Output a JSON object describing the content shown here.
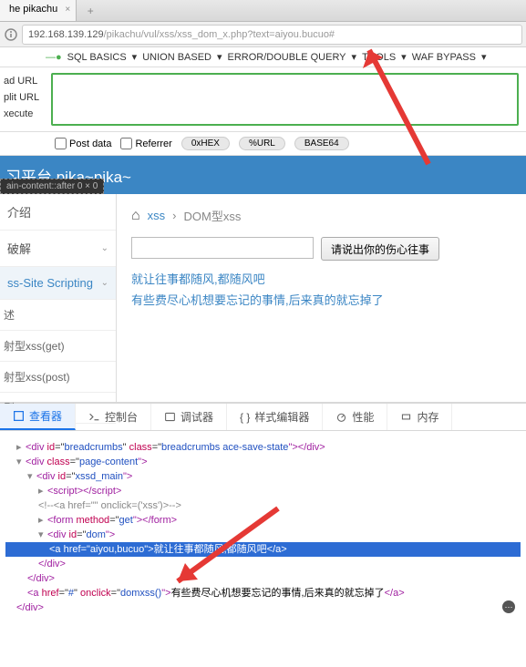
{
  "tab": {
    "title": "he pikachu"
  },
  "url": {
    "host": "192.168.139.129",
    "path": "/pikachu/vul/xss/xss_dom_x.php?text=aiyou.bucuo#"
  },
  "hackbar": {
    "items": [
      "SQL BASICS",
      "UNION BASED",
      "ERROR/DOUBLE QUERY",
      "TOOLS",
      "WAF BYPASS"
    ],
    "left": [
      "ad URL",
      "plit URL",
      "xecute"
    ],
    "opts": {
      "post": "Post data",
      "ref": "Referrer",
      "hex": "0xHEX",
      "url": "%URL",
      "b64": "BASE64"
    }
  },
  "page": {
    "title": "习平台 pika~pika~",
    "badge": "ain-content::after      0 × 0",
    "crumb": {
      "l1": "xss",
      "l2": "DOM型xss"
    },
    "btn": "请说出你的伤心往事",
    "link1": "就让往事都随风,都随风吧",
    "link2": "有些费尽心机想要忘记的事情,后来真的就忘掉了"
  },
  "sidebar": {
    "items": [
      "介绍",
      "破解"
    ],
    "open": "ss-Site Scripting",
    "subs": [
      "述",
      "射型xss(get)",
      "射型xss(post)",
      "型"
    ]
  },
  "devtools": {
    "tabs": [
      "查看器",
      "控制台",
      "调试器",
      "样式编辑器",
      "性能",
      "内存"
    ],
    "code": {
      "l1a": "<div ",
      "l1b": "id",
      "l1c": "=\"",
      "l1d": "breadcrumbs",
      "l1e": "\" ",
      "l1f": "class",
      "l1g": "=\"",
      "l1h": "breadcrumbs ace-save-state",
      "l1i": "\"></div>",
      "l2a": "<div ",
      "l2b": "class",
      "l2c": "=\"",
      "l2d": "page-content",
      "l2e": "\">",
      "l3a": "<div ",
      "l3b": "id",
      "l3c": "=\"",
      "l3d": "xssd_main",
      "l3e": "\">",
      "l4": "<script></script",
      "l5": "<!--<a href=\"\" onclick=('xss')>-->",
      "l6a": "<form ",
      "l6b": "method",
      "l6c": "=\"",
      "l6d": "get",
      "l6e": "\"></form>",
      "l7a": "<div ",
      "l7b": "id",
      "l7c": "=\"",
      "l7d": "dom",
      "l7e": "\">",
      "l8a": "<a ",
      "l8b": "href",
      "l8c": "=\"",
      "l8d": "aiyou,bucuo",
      "l8e": "\">",
      "l8f": "就让往事都随风,都随风吧",
      "l8g": "</a>",
      "l9": "</div>",
      "l10a": "<a ",
      "l10b": "href",
      "l10c": "=\"",
      "l10d": "#",
      "l10e": "\" ",
      "l10f": "onclick",
      "l10g": "=\"",
      "l10h": "domxss()",
      "l10i": "\">",
      "l10j": "有些费尽心机想要忘记的事情,后来真的就忘掉了",
      "l10k": "</a>",
      "bubble": "⋯"
    }
  }
}
